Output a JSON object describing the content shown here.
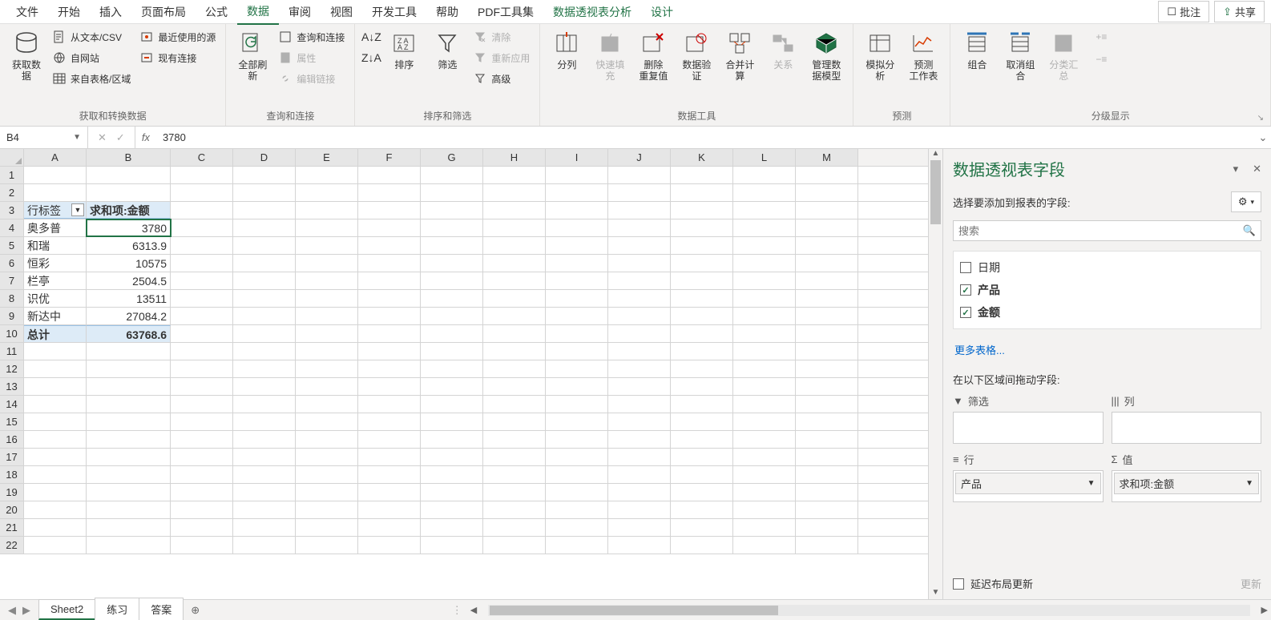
{
  "tabs": {
    "file": "文件",
    "home": "开始",
    "insert": "插入",
    "pageLayout": "页面布局",
    "formulas": "公式",
    "data": "数据",
    "review": "审阅",
    "view": "视图",
    "developer": "开发工具",
    "help": "帮助",
    "pdf": "PDF工具集",
    "pivotAnalyze": "数据透视表分析",
    "design": "设计"
  },
  "topRight": {
    "comment": "批注",
    "share": "共享"
  },
  "ribbon": {
    "getData": {
      "mainBtn": "获取数\n据",
      "fromText": "从文本/CSV",
      "fromWeb": "自网站",
      "fromTable": "来自表格/区域",
      "recent": "最近使用的源",
      "existing": "现有连接",
      "groupLabel": "获取和转换数据"
    },
    "queries": {
      "refreshAll": "全部刷新",
      "queries": "查询和连接",
      "properties": "属性",
      "editLinks": "编辑链接",
      "groupLabel": "查询和连接"
    },
    "sortFilter": {
      "sort": "排序",
      "filter": "筛选",
      "clear": "清除",
      "reapply": "重新应用",
      "advanced": "高级",
      "groupLabel": "排序和筛选"
    },
    "dataTools": {
      "textToCol": "分列",
      "flashFill": "快速填充",
      "removeDup": "删除\n重复值",
      "validation": "数据验\n证",
      "consolidate": "合并计算",
      "relations": "关系",
      "dataModel": "管理数\n据模型",
      "groupLabel": "数据工具"
    },
    "forecast": {
      "whatIf": "模拟分析",
      "forecast": "预测\n工作表",
      "groupLabel": "预测"
    },
    "outline": {
      "group": "组合",
      "ungroup": "取消组合",
      "subtotal": "分类汇总",
      "groupLabel": "分级显示"
    }
  },
  "nameBox": "B4",
  "formulaBar": "3780",
  "columns": [
    "A",
    "B",
    "C",
    "D",
    "E",
    "F",
    "G",
    "H",
    "I",
    "J",
    "K",
    "L",
    "M"
  ],
  "pivot": {
    "header": {
      "rowLabel": "行标签",
      "sumLabel": "求和项:金额"
    },
    "rows": [
      {
        "label": "奥多普",
        "value": "3780"
      },
      {
        "label": "和瑞",
        "value": "6313.9"
      },
      {
        "label": "恒彩",
        "value": "10575"
      },
      {
        "label": "栏亭",
        "value": "2504.5"
      },
      {
        "label": "识优",
        "value": "13511"
      },
      {
        "label": "新达中",
        "value": "27084.2"
      }
    ],
    "total": {
      "label": "总计",
      "value": "63768.6"
    }
  },
  "pane": {
    "title": "数据透视表字段",
    "subtitle": "选择要添加到报表的字段:",
    "searchPlaceholder": "搜索",
    "fields": [
      {
        "name": "日期",
        "checked": false
      },
      {
        "name": "产品",
        "checked": true
      },
      {
        "name": "金额",
        "checked": true
      }
    ],
    "moreTables": "更多表格...",
    "dragLabel": "在以下区域间拖动字段:",
    "areas": {
      "filter": "筛选",
      "columns": "列",
      "rows": "行",
      "values": "值",
      "rowItem": "产品",
      "valueItem": "求和项:金额"
    },
    "deferLabel": "延迟布局更新",
    "updateBtn": "更新"
  },
  "sheets": {
    "s1": "Sheet2",
    "s2": "练习",
    "s3": "答案"
  }
}
